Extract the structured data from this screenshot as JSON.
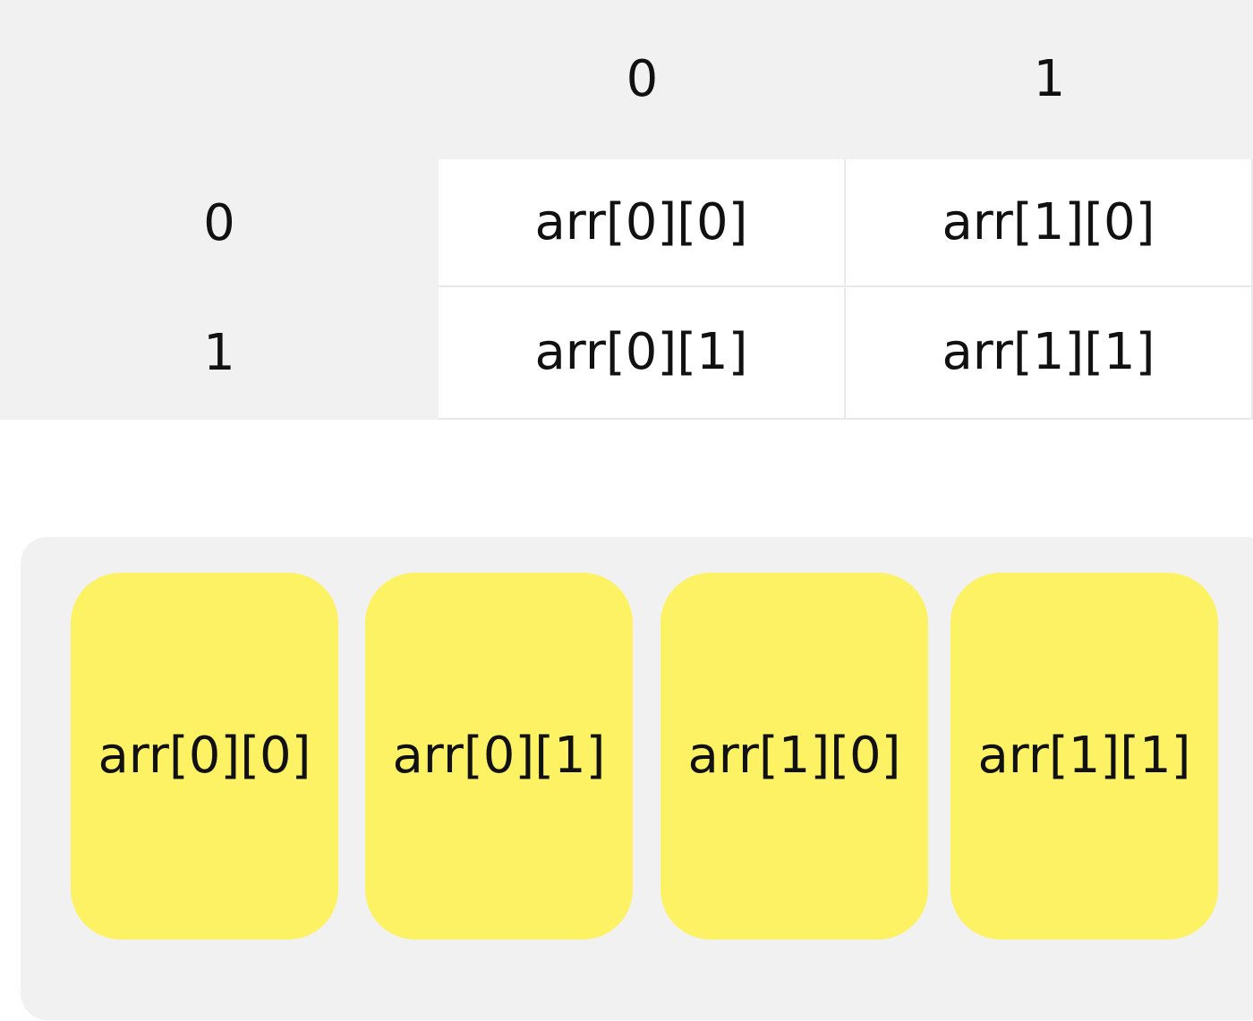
{
  "table": {
    "column_headers": [
      "0",
      "1"
    ],
    "row_headers": [
      "0",
      "1"
    ],
    "rows": [
      [
        "arr[0][0]",
        "arr[1][0]"
      ],
      [
        "arr[0][1]",
        "arr[1][1]"
      ]
    ]
  },
  "memory_layout": {
    "slots": [
      "arr[0][0]",
      "arr[0][1]",
      "arr[1][0]",
      "arr[1][1]"
    ]
  },
  "colors": {
    "header_background": "#f1f1f1",
    "cell_background": "#ffffff",
    "slot_fill": "#fcf264",
    "text": "#111111"
  }
}
